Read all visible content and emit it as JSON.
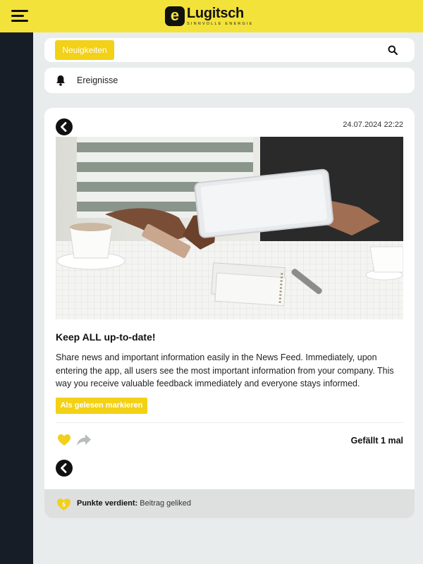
{
  "header": {
    "logo_mark": "e",
    "logo_name": "Lugitsch",
    "logo_tagline": "SINNVOLLE ENERGIE",
    "accent_color": "#f3e23a"
  },
  "toolbar": {
    "news_label": "Neuigkeiten",
    "search_icon": "search-icon"
  },
  "events": {
    "label": "Ereignisse",
    "icon": "bell-icon"
  },
  "post": {
    "timestamp": "24.07.2024 22:22",
    "title": "Keep ALL up-to-date!",
    "body": "Share news and important information easily in the News Feed. Immediately, upon entering the app, all users see the most important information from your company. This way you receive valuable feedback immediately and everyone stays informed.",
    "mark_read_label": "Als gelesen markieren",
    "likes_label": "Gefällt 1 mal"
  },
  "points": {
    "badge_count": "5",
    "label": "Punkte verdient:",
    "reason": "Beitrag geliked"
  }
}
